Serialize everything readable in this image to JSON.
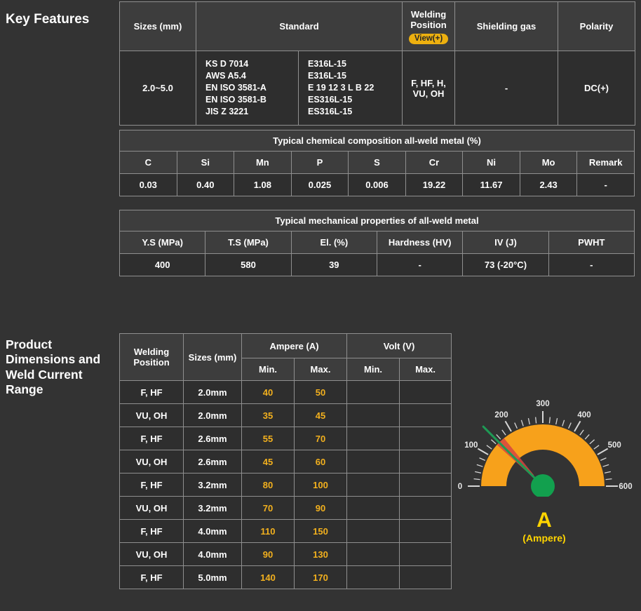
{
  "page": {
    "background": "#333333",
    "accent_yellow": "#EDB00F",
    "section_titles": {
      "key_features": "Key Features",
      "product_dimensions": "Product Dimensions and Weld Current Range"
    }
  },
  "spec_table": {
    "headers": {
      "sizes": "Sizes (mm)",
      "standard": "Standard",
      "welding_position": "Welding Position",
      "view_button": "View(+)",
      "shielding_gas": "Shielding gas",
      "polarity": "Polarity"
    },
    "row": {
      "sizes": "2.0~5.0",
      "standards_codes": [
        "KS D 7014",
        "AWS A5.4",
        "EN ISO 3581-A",
        "EN ISO 3581-B",
        "JIS Z 3221"
      ],
      "standards_grades": [
        "E316L-15",
        "E316L-15",
        "E 19 12 3 L B 22",
        "ES316L-15",
        "ES316L-15"
      ],
      "welding_position": "F, HF, H, VU, OH",
      "shielding_gas": "-",
      "polarity": "DC(+)"
    }
  },
  "chemical_table": {
    "title": "Typical chemical composition all-weld metal (%)",
    "headers": [
      "C",
      "Si",
      "Mn",
      "P",
      "S",
      "Cr",
      "Ni",
      "Mo",
      "Remark"
    ],
    "values": [
      "0.03",
      "0.40",
      "1.08",
      "0.025",
      "0.006",
      "19.22",
      "11.67",
      "2.43",
      "-"
    ]
  },
  "mechanical_table": {
    "title": "Typical mechanical properties of all-weld metal",
    "headers": [
      "Y.S (MPa)",
      "T.S (MPa)",
      "El. (%)",
      "Hardness (HV)",
      "IV (J)",
      "PWHT"
    ],
    "values": [
      "400",
      "580",
      "39",
      "-",
      "73 (-20°C)",
      "-"
    ]
  },
  "current_table": {
    "headers": {
      "welding_position": "Welding Position",
      "sizes": "Sizes (mm)",
      "ampere": "Ampere (A)",
      "volt": "Volt (V)",
      "min": "Min.",
      "max": "Max."
    },
    "value_color": "#F2B01E",
    "rows": [
      {
        "position": "F, HF",
        "size": "2.0mm",
        "amp_min": "40",
        "amp_max": "50",
        "volt_min": "",
        "volt_max": ""
      },
      {
        "position": "VU, OH",
        "size": "2.0mm",
        "amp_min": "35",
        "amp_max": "45",
        "volt_min": "",
        "volt_max": ""
      },
      {
        "position": "F, HF",
        "size": "2.6mm",
        "amp_min": "55",
        "amp_max": "70",
        "volt_min": "",
        "volt_max": ""
      },
      {
        "position": "VU, OH",
        "size": "2.6mm",
        "amp_min": "45",
        "amp_max": "60",
        "volt_min": "",
        "volt_max": ""
      },
      {
        "position": "F, HF",
        "size": "3.2mm",
        "amp_min": "80",
        "amp_max": "100",
        "volt_min": "",
        "volt_max": ""
      },
      {
        "position": "VU, OH",
        "size": "3.2mm",
        "amp_min": "70",
        "amp_max": "90",
        "volt_min": "",
        "volt_max": ""
      },
      {
        "position": "F, HF",
        "size": "4.0mm",
        "amp_min": "110",
        "amp_max": "150",
        "volt_min": "",
        "volt_max": ""
      },
      {
        "position": "VU, OH",
        "size": "4.0mm",
        "amp_min": "90",
        "amp_max": "130",
        "volt_min": "",
        "volt_max": ""
      },
      {
        "position": "F, HF",
        "size": "5.0mm",
        "amp_min": "140",
        "amp_max": "170",
        "volt_min": "",
        "volt_max": ""
      }
    ]
  },
  "gauge": {
    "type": "gauge",
    "min": 0,
    "max": 600,
    "tick_step": 20,
    "major_step": 100,
    "tick_labels": [
      "0",
      "100",
      "200",
      "300",
      "400",
      "500",
      "600"
    ],
    "needle_value": 150,
    "highlight_range": [
      140,
      170
    ],
    "unit": "A",
    "unit_label": "(Ampere)",
    "colors": {
      "arc": "#F7A11B",
      "needle": "#1E9A55",
      "hub": "#12A04E",
      "range": "rgba(214,69,65,0.85)",
      "ticks": "#D6D6D6",
      "labels": "#E8E8E8",
      "unit_text": "#FFD400"
    }
  }
}
